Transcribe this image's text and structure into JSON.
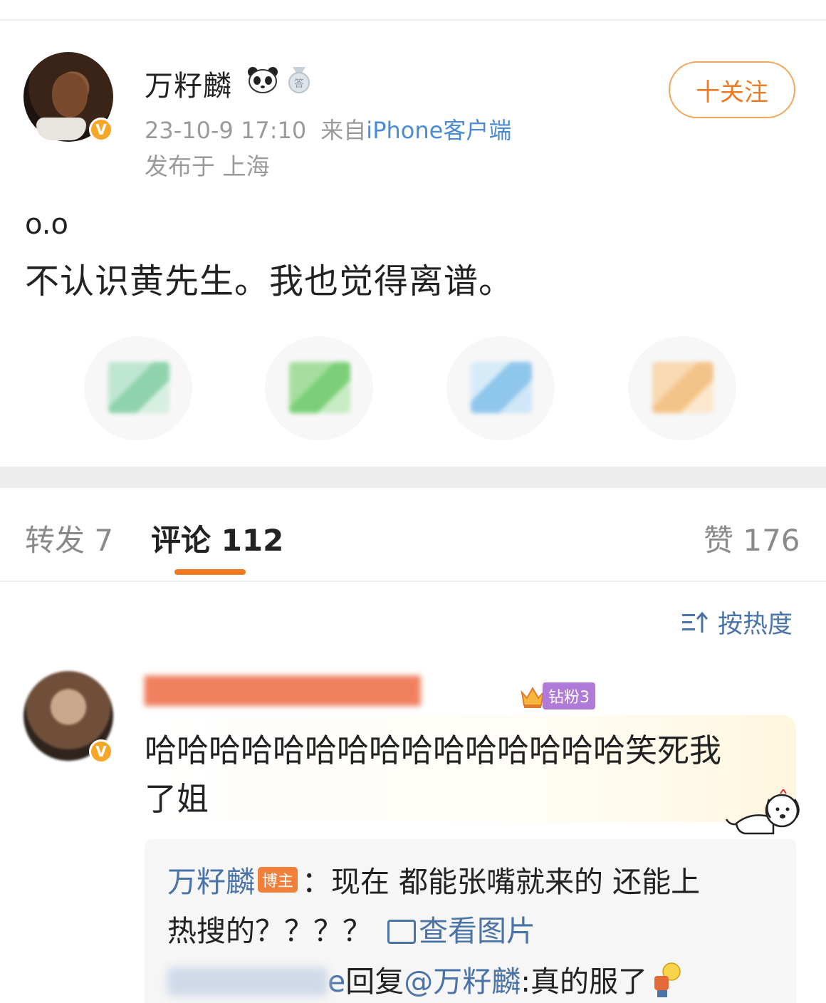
{
  "post": {
    "author": "万籽麟",
    "time": "23-10-9 17:10",
    "source_prefix": "来自",
    "source_client": "iPhone客户端",
    "location": "发布于 上海",
    "follow_label": "十关注",
    "text_line1": "o.o",
    "text_line2": "不认识黄先生。我也觉得离谱。",
    "verified_mark": "V"
  },
  "share_icons": [
    "wechat-icon",
    "moments-icon",
    "qq-icon",
    "weibo-share-icon"
  ],
  "tabs": [
    {
      "label": "转发 7"
    },
    {
      "label": "评论 112"
    },
    {
      "label": "赞 176"
    }
  ],
  "sort_label": "按热度",
  "comment": {
    "fan_badge": "钻粉3",
    "text_line1": "哈哈哈哈哈哈哈哈哈哈哈哈哈哈哈笑死我",
    "text_line2": "了姐",
    "verified_mark": "V"
  },
  "replies": {
    "r1_name": "万籽麟",
    "r1_badge": "博主",
    "r1_text": "：现在 都能张嘴就来的 还能上",
    "r2_text": "热搜的？？？？",
    "r2_view": "查看图片",
    "r3_tail": "e",
    "r3_reply": "回复",
    "r3_at": "@万籽麟",
    "r3_text": ":真的服了"
  },
  "colors": {
    "accent": "#f07a21",
    "link": "#4a73a8",
    "verified": "#f7a728"
  }
}
